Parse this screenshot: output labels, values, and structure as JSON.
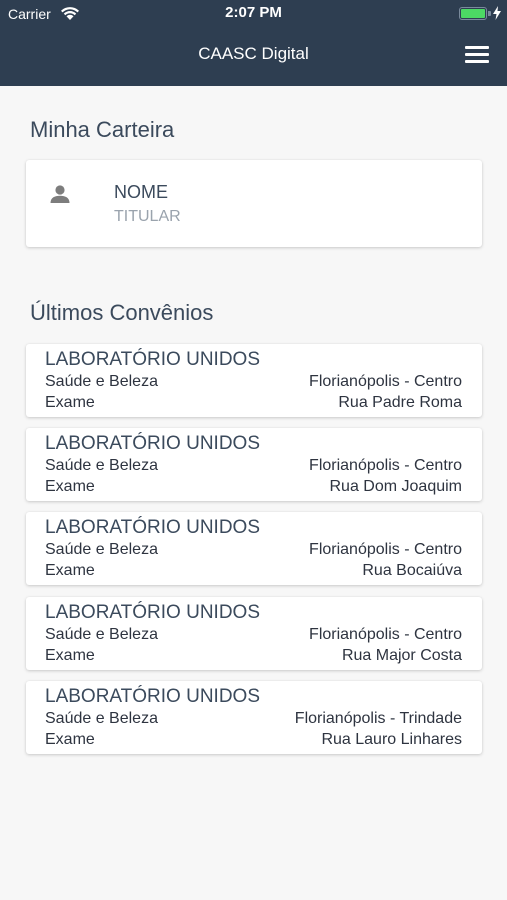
{
  "status_bar": {
    "carrier": "Carrier",
    "time": "2:07 PM"
  },
  "nav": {
    "title": "CAASC Digital",
    "menu_icon": "hamburger-menu-icon"
  },
  "wallet": {
    "section_title": "Minha Carteira",
    "name": "NOME",
    "role": "TITULAR",
    "icon": "person-icon"
  },
  "convenios": {
    "section_title": "Últimos Convênios",
    "items": [
      {
        "name": "LABORATÓRIO UNIDOS",
        "category": "Saúde e Beleza",
        "type": "Exame",
        "city": "Florianópolis - Centro",
        "street": "Rua Padre Roma"
      },
      {
        "name": "LABORATÓRIO UNIDOS",
        "category": "Saúde e Beleza",
        "type": "Exame",
        "city": "Florianópolis - Centro",
        "street": "Rua Dom Joaquim"
      },
      {
        "name": "LABORATÓRIO UNIDOS",
        "category": "Saúde e Beleza",
        "type": "Exame",
        "city": "Florianópolis - Centro",
        "street": "Rua Bocaiúva"
      },
      {
        "name": "LABORATÓRIO UNIDOS",
        "category": "Saúde e Beleza",
        "type": "Exame",
        "city": "Florianópolis - Centro",
        "street": "Rua Major Costa"
      },
      {
        "name": "LABORATÓRIO UNIDOS",
        "category": "Saúde e Beleza",
        "type": "Exame",
        "city": "Florianópolis - Trindade",
        "street": "Rua Lauro Linhares"
      }
    ]
  },
  "colors": {
    "header": "#2e3e51",
    "background": "#f7f7f7",
    "text": "#3b4a5c",
    "muted": "#9aa3ad",
    "battery": "#4cd964"
  }
}
